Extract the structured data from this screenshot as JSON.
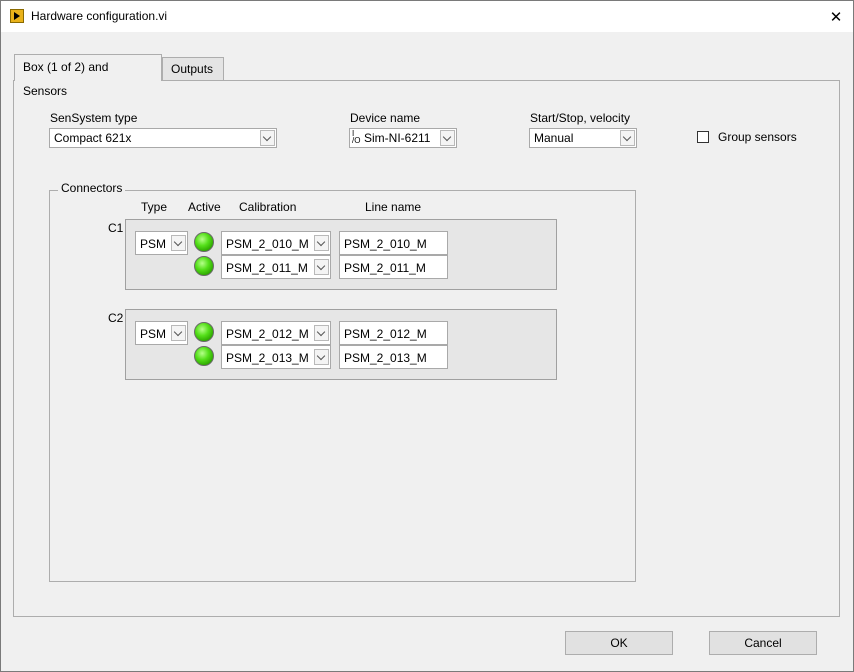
{
  "window": {
    "title": "Hardware configuration.vi",
    "close_glyph": "✕"
  },
  "tabs": [
    {
      "label": "Box (1 of 2) and Sensors",
      "active": true
    },
    {
      "label": "Outputs",
      "active": false
    }
  ],
  "sensystem": {
    "label": "SenSystem type",
    "value": "Compact 621x"
  },
  "device": {
    "label": "Device name",
    "value": "Sim-NI-6211",
    "icon_glyph": "I/O"
  },
  "startstop": {
    "label": "Start/Stop, velocity",
    "value": "Manual"
  },
  "group_sensors": {
    "label": "Group sensors",
    "checked": false
  },
  "connectors": {
    "label": "Connectors",
    "headers": {
      "type": "Type",
      "active": "Active",
      "calibration": "Calibration",
      "line_name": "Line name"
    },
    "items": [
      {
        "name": "C1",
        "type": "PSM",
        "rows": [
          {
            "calibration": "PSM_2_010_M",
            "line_name": "PSM_2_010_M",
            "active": true
          },
          {
            "calibration": "PSM_2_011_M",
            "line_name": "PSM_2_011_M",
            "active": true
          }
        ]
      },
      {
        "name": "C2",
        "type": "PSM",
        "rows": [
          {
            "calibration": "PSM_2_012_M",
            "line_name": "PSM_2_012_M",
            "active": true
          },
          {
            "calibration": "PSM_2_013_M",
            "line_name": "PSM_2_013_M",
            "active": true
          }
        ]
      }
    ]
  },
  "buttons": {
    "ok": "OK",
    "cancel": "Cancel"
  },
  "colors": {
    "led_on": "#55e01a",
    "title_icon": "#e9b21a"
  }
}
